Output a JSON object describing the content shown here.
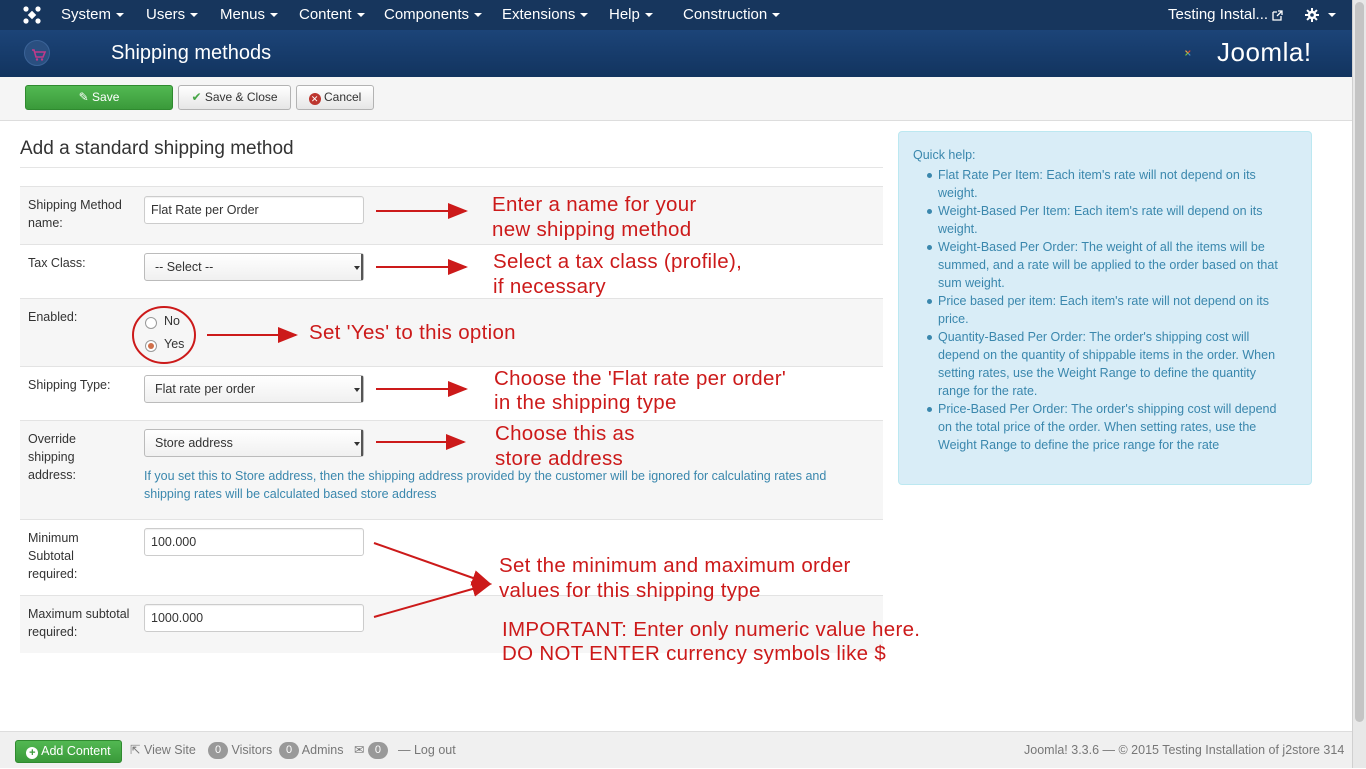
{
  "navbar": {
    "menus": [
      "System",
      "Users",
      "Menus",
      "Content",
      "Components",
      "Extensions",
      "Help",
      "Construction"
    ],
    "site_name": "Testing Instal...",
    "settings_icon": "gear-icon"
  },
  "header": {
    "title": "Shipping methods",
    "logo_text": "Joomla!"
  },
  "toolbar": {
    "save": "Save",
    "save_close": "Save & Close",
    "cancel": "Cancel"
  },
  "form": {
    "heading": "Add a standard shipping method",
    "name_label": "Shipping Method name:",
    "name_value": "Flat Rate per Order",
    "tax_label": "Tax Class:",
    "tax_value": "-- Select --",
    "enabled_label": "Enabled:",
    "enabled_no": "No",
    "enabled_yes": "Yes",
    "enabled_selected": "Yes",
    "type_label": "Shipping Type:",
    "type_value": "Flat rate per order",
    "override_label": "Override shipping address:",
    "override_value": "Store address",
    "override_help": "If you set this to Store address, then the shipping address provided by the customer will be ignored for calculating rates and shipping rates will be calculated based store address",
    "min_label": "Minimum Subtotal required:",
    "min_value": "100.000",
    "max_label": "Maximum subtotal required:",
    "max_value": "1000.000"
  },
  "annotations": {
    "name_1": "Enter a name for your",
    "name_2": "new shipping method",
    "tax_1": "Select a tax class (profile),",
    "tax_2": "if necessary",
    "enabled": "Set 'Yes' to this option",
    "type_1": "Choose the 'Flat rate per order'",
    "type_2": "in the shipping type",
    "override_1": "Choose this as",
    "override_2": "store address",
    "minmax_1": "Set the minimum and maximum order",
    "minmax_2": "values for this shipping type",
    "important_1": "IMPORTANT: Enter only numeric value here.",
    "important_2": "DO NOT ENTER currency symbols like $",
    "color": "#cc1a1a"
  },
  "quick_help": {
    "title": "Quick help:",
    "items": [
      "Flat Rate Per Item: Each item's rate will not depend on its weight.",
      "Weight-Based Per Item: Each item's rate will depend on its weight.",
      "Weight-Based Per Order: The weight of all the items will be summed, and a rate will be applied to the order based on that sum weight.",
      "Price based per item: Each item's rate will not depend on its price.",
      "Quantity-Based Per Order: The order's shipping cost will depend on the quantity of shippable items in the order. When setting rates, use the Weight Range to define the quantity range for the rate.",
      "Price-Based Per Order: The order's shipping cost will depend on the total price of the order. When setting rates, use the Weight Range to define the price range for the rate"
    ]
  },
  "statusbar": {
    "add_content": "Add Content",
    "view_site": "View Site",
    "visitors_count": "0",
    "visitors": "Visitors",
    "admins_count": "0",
    "admins": "Admins",
    "messages_count": "0",
    "logout": "Log out",
    "footer": "Joomla! 3.3.6  —  © 2015 Testing Installation of j2store 314"
  }
}
